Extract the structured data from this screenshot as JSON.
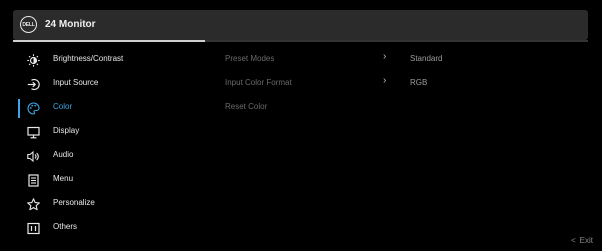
{
  "header": {
    "logo_text": "DELL",
    "title": "24 Monitor"
  },
  "menu": [
    {
      "label": "Brightness/Contrast",
      "icon": "brightness-icon",
      "active": false
    },
    {
      "label": "Input Source",
      "icon": "input-source-icon",
      "active": false
    },
    {
      "label": "Color",
      "icon": "color-palette-icon",
      "active": true
    },
    {
      "label": "Display",
      "icon": "display-icon",
      "active": false
    },
    {
      "label": "Audio",
      "icon": "speaker-icon",
      "active": false
    },
    {
      "label": "Menu",
      "icon": "menu-icon",
      "active": false
    },
    {
      "label": "Personalize",
      "icon": "star-icon",
      "active": false
    },
    {
      "label": "Others",
      "icon": "others-icon",
      "active": false
    }
  ],
  "submenu": [
    {
      "label": "Preset Modes",
      "value": "Standard",
      "has_arrow": true
    },
    {
      "label": "Input Color Format",
      "value": "RGB",
      "has_arrow": true
    },
    {
      "label": "Reset Color",
      "value": "",
      "has_arrow": false
    }
  ],
  "exit": {
    "label": "Exit"
  },
  "colors": {
    "accent": "#3fa5e8",
    "background": "#000000",
    "header": "#2b2b2b"
  }
}
